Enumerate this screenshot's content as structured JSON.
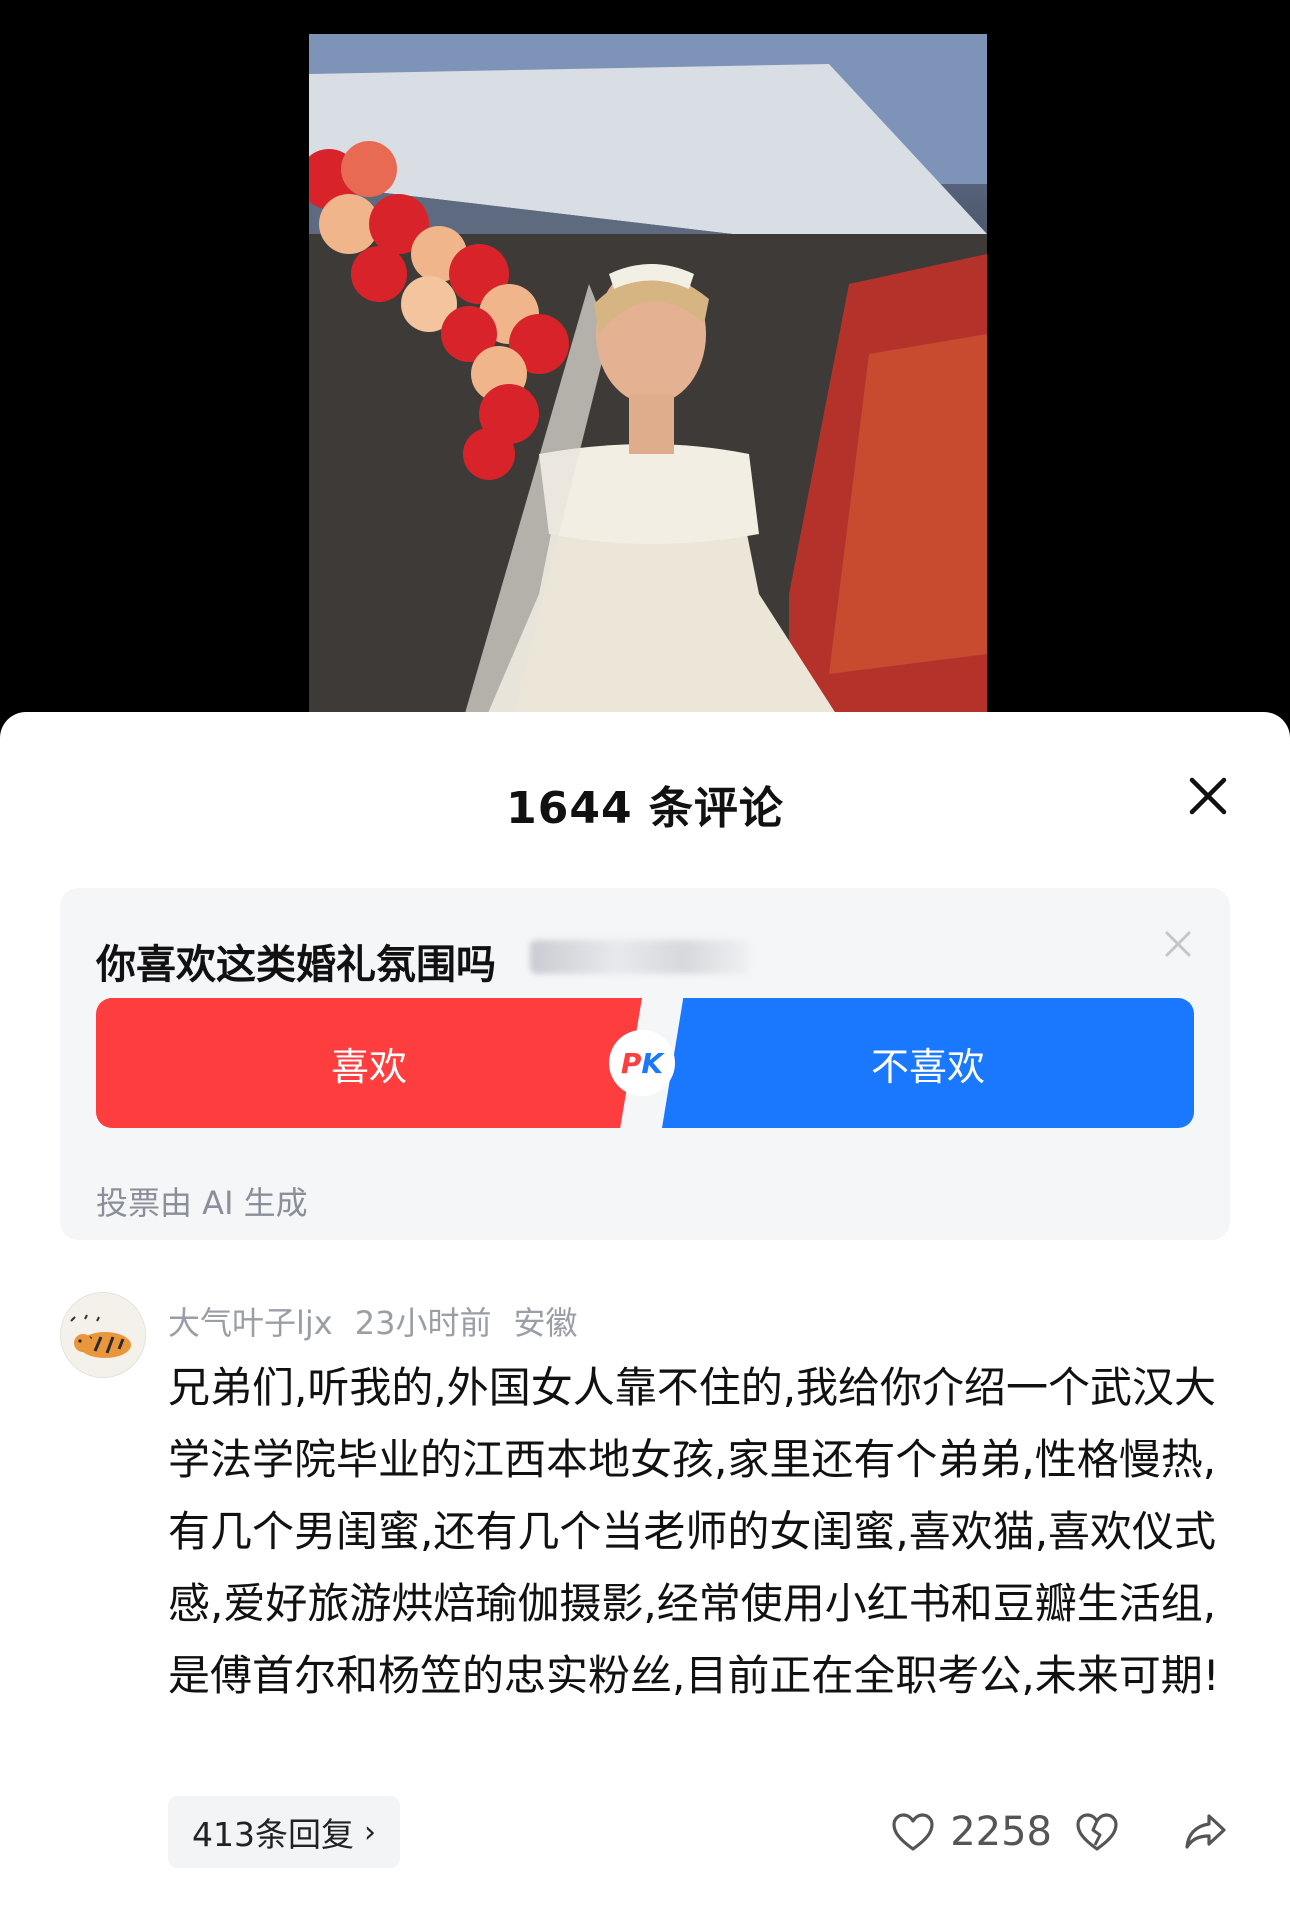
{
  "sheet": {
    "title": "1644 条评论"
  },
  "poll": {
    "question": "你喜欢这类婚礼氛围吗",
    "option_like": "喜欢",
    "option_dislike": "不喜欢",
    "pk_p": "P",
    "pk_k": "K",
    "note": "投票由 AI 生成"
  },
  "comment": {
    "username": "大气叶子ljx",
    "time": "23小时前",
    "location": "安徽",
    "text": "兄弟们,听我的,外国女人靠不住的,我给你介绍一个武汉大学法学院毕业的江西本地女孩,家里还有个弟弟,性格慢热,有几个男闺蜜,还有几个当老师的女闺蜜,喜欢猫,喜欢仪式感,爱好旅游烘焙瑜伽摄影,经常使用小红书和豆瓣生活组,是傅首尔和杨笠的忠实粉丝,目前正在全职考公,未来可期!",
    "replies_label": "413条回复",
    "likes": "2258"
  },
  "colors": {
    "like_red": "#fe3e3e",
    "dislike_blue": "#1a78ff"
  }
}
